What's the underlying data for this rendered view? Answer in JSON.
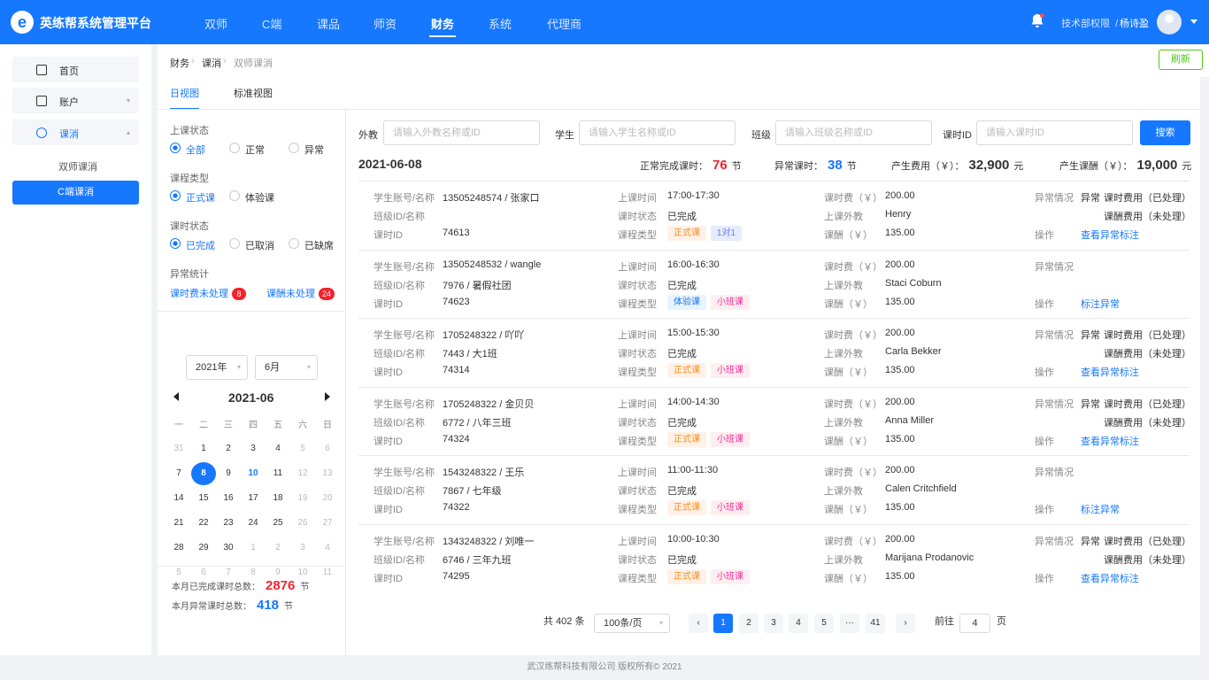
{
  "header": {
    "brand": "英练帮系统管理平台",
    "nav": [
      "双师",
      "C端",
      "课品",
      "师资",
      "财务",
      "系统",
      "代理商"
    ],
    "active_nav": "财务",
    "permission": "技术部权限",
    "separator": "/",
    "user": "杨诗盈"
  },
  "sidebar": {
    "items": [
      {
        "label": "首页"
      },
      {
        "label": "账户"
      },
      {
        "label": "课消"
      }
    ],
    "sub": "双师课消",
    "active": "C端课消"
  },
  "breadcrumb": [
    "财务",
    "课消",
    "双师课消"
  ],
  "refresh": "刷新",
  "tabs": [
    "日视图",
    "标准视图"
  ],
  "filters": {
    "status_title": "上课状态",
    "status": [
      "全部",
      "正常",
      "异常"
    ],
    "type_title": "课程类型",
    "type": [
      "正式课",
      "体验课"
    ],
    "hour_title": "课时状态",
    "hour": [
      "已完成",
      "已取消",
      "已缺席"
    ],
    "anom_title": "异常统计",
    "anom_fee": "课时费未处理",
    "anom_fee_count": "8",
    "anom_pay": "课酬未处理",
    "anom_pay_count": "24"
  },
  "calendar": {
    "year": "2021年",
    "month": "6月",
    "title": "2021-06",
    "weekdays": [
      "一",
      "二",
      "三",
      "四",
      "五",
      "六",
      "日"
    ],
    "days": [
      [
        "31",
        "1",
        "2",
        "3",
        "4",
        "5",
        "6"
      ],
      [
        "7",
        "8",
        "9",
        "10",
        "11",
        "12",
        "13"
      ],
      [
        "14",
        "15",
        "16",
        "17",
        "18",
        "19",
        "20"
      ],
      [
        "21",
        "22",
        "23",
        "24",
        "25",
        "26",
        "27"
      ],
      [
        "28",
        "29",
        "30",
        "1",
        "2",
        "3",
        "4"
      ],
      [
        "5",
        "6",
        "7",
        "8",
        "9",
        "10",
        "11"
      ]
    ]
  },
  "summary": {
    "done_label": "本月已完成课时总数：",
    "done": "2876",
    "anom_label": "本月异常课时总数：",
    "anom": "418",
    "unit": "节"
  },
  "search": {
    "teacher_label": "外教",
    "teacher_ph": "请输入外教名称或ID",
    "student_label": "学生",
    "student_ph": "请输入学生名称或ID",
    "class_label": "班级",
    "class_ph": "请输入班级名称或ID",
    "hour_label": "课时ID",
    "hour_ph": "请输入课时ID",
    "button": "搜索"
  },
  "day": {
    "date": "2021-06-08",
    "normal_label": "正常完成课时：",
    "normal": "76",
    "normal_unit": "节",
    "abn_label": "异常课时：",
    "abn": "38",
    "abn_unit": "节",
    "fee_label": "产生费用（￥）：",
    "fee": "32,900",
    "fee_unit": "元",
    "pay_label": "产生课酬（￥）：",
    "pay": "19,000",
    "pay_unit": "元"
  },
  "labels": {
    "account": "学生账号/名称",
    "class": "班级ID/名称",
    "hour_id": "课时ID",
    "time": "上课时间",
    "status": "课时状态",
    "type": "课程类型",
    "fee": "课时费（￥）",
    "teacher": "上课外教",
    "pay": "课酬（￥）",
    "abn": "异常情况",
    "op": "操作"
  },
  "records": [
    {
      "account": "13505248574 / 张家口",
      "class": "",
      "id": "74613",
      "time": "17:00-17:30",
      "status": "已完成",
      "tag1": "正式课",
      "tag2": "1对1",
      "fee": "200.00",
      "teacher": "Henry",
      "pay": "135.00",
      "abn": "异常",
      "abn1": "课时费用（已处理）",
      "abn2": "课酬费用（未处理）",
      "op": "查看异常标注"
    },
    {
      "account": "13505248532 / wangle",
      "class": "7976 / 暑假社团",
      "id": "74623",
      "time": "16:00-16:30",
      "status": "已完成",
      "tag1": "体验课",
      "tag2": "小班课",
      "fee": "200.00",
      "teacher": "Staci Coburn",
      "pay": "135.00",
      "abn": "",
      "abn1": "",
      "abn2": "",
      "op": "标注异常"
    },
    {
      "account": "1705248322 / 吖吖",
      "class": "7443 / 大1班",
      "id": "74314",
      "time": "15:00-15:30",
      "status": "已完成",
      "tag1": "正式课",
      "tag2": "小班课",
      "fee": "200.00",
      "teacher": "Carla Bekker",
      "pay": "135.00",
      "abn": "异常",
      "abn1": "课时费用（已处理）",
      "abn2": "课酬费用（未处理）",
      "op": "查看异常标注"
    },
    {
      "account": "1705248322 / 金贝贝",
      "class": "6772 / 八年三班",
      "id": "74324",
      "time": "14:00-14:30",
      "status": "已完成",
      "tag1": "正式课",
      "tag2": "小班课",
      "fee": "200.00",
      "teacher": "Anna Miller",
      "pay": "135.00",
      "abn": "异常",
      "abn1": "课时费用（已处理）",
      "abn2": "课酬费用（未处理）",
      "op": "查看异常标注"
    },
    {
      "account": "1543248322 / 王乐",
      "class": "7867 / 七年级",
      "id": "74322",
      "time": "11:00-11:30",
      "status": "已完成",
      "tag1": "正式课",
      "tag2": "小班课",
      "fee": "200.00",
      "teacher": "Calen Critchfield",
      "pay": "135.00",
      "abn": "",
      "abn1": "",
      "abn2": "",
      "op": "标注异常"
    },
    {
      "account": "1343248322 / 刘唯一",
      "class": "6746 / 三年九班",
      "id": "74295",
      "time": "10:00-10:30",
      "status": "已完成",
      "tag1": "正式课",
      "tag2": "小班课",
      "fee": "200.00",
      "teacher": "Marijana Prodanovic",
      "pay": "135.00",
      "abn": "异常",
      "abn1": "课时费用（已处理）",
      "abn2": "课酬费用（未处理）",
      "op": "查看异常标注"
    }
  ],
  "pagination": {
    "total": "共 402 条",
    "size": "100条/页",
    "pages": [
      "1",
      "2",
      "3",
      "4",
      "5",
      "···",
      "41"
    ],
    "goto_label": "前往",
    "goto_value": "4",
    "goto_unit": "页"
  },
  "footer": "武汉练帮科技有限公司 版权所有© 2021",
  "colors": {
    "primary": "#1677ff",
    "danger": "#f5222d",
    "success": "#52c41a"
  }
}
